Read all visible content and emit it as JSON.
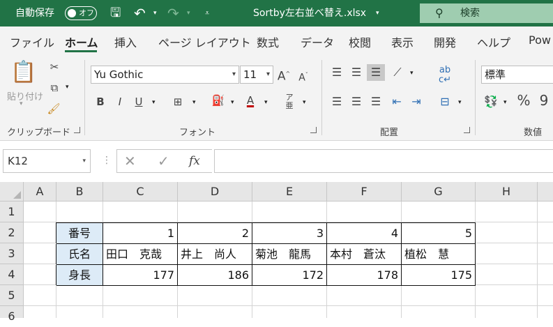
{
  "titlebar": {
    "autosave_label": "自動保存",
    "autosave_state": "オフ",
    "filename": "Sortby左右並べ替え.xlsx",
    "search_placeholder": "検索",
    "bg_color": "#217346"
  },
  "tabs": [
    "ファイル",
    "ホーム",
    "挿入",
    "ページ レイアウト",
    "数式",
    "データ",
    "校閲",
    "表示",
    "開発",
    "ヘルプ",
    "Pow"
  ],
  "active_tab": "ホーム",
  "ribbon": {
    "clipboard": {
      "paste_label": "貼り付け",
      "group_label": "クリップボード"
    },
    "font": {
      "font_name": "Yu Gothic",
      "font_size": "11",
      "bold": "B",
      "italic": "I",
      "underline": "U",
      "group_label": "フォント"
    },
    "alignment": {
      "group_label": "配置"
    },
    "number": {
      "format": "標準",
      "percent": "%",
      "group_label": "数値"
    }
  },
  "formula_bar": {
    "name_box": "K12",
    "fx": "fx",
    "formula": ""
  },
  "columns": [
    "A",
    "B",
    "C",
    "D",
    "E",
    "F",
    "G",
    "H"
  ],
  "rows": [
    "1",
    "2",
    "3",
    "4",
    "5",
    "6"
  ],
  "table": {
    "header_labels": [
      "番号",
      "氏名",
      "身長"
    ],
    "numbers": [
      "1",
      "2",
      "3",
      "4",
      "5"
    ],
    "names": [
      "田口　克哉",
      "井上　尚人",
      "菊池　龍馬",
      "本村　蒼汰",
      "植松　慧"
    ],
    "heights": [
      "177",
      "186",
      "172",
      "178",
      "175"
    ]
  },
  "colors": {
    "accent": "#217346",
    "header_fill": "#ddebf7"
  }
}
